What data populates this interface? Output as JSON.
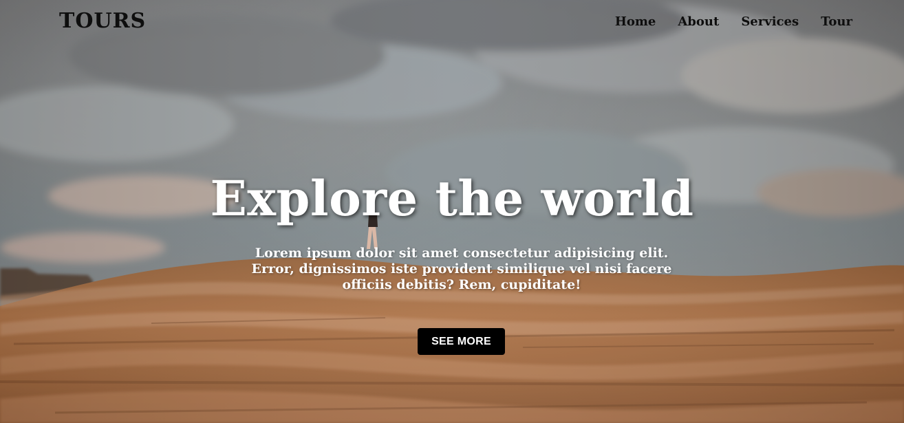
{
  "navbar": {
    "brand": "TOURS",
    "links": [
      "Home",
      "About",
      "Services",
      "Tour"
    ]
  },
  "hero": {
    "title": "Explore the world",
    "description": "Lorem ipsum dolor sit amet consectetur adipisicing elit. Error, dignissimos iste provident similique vel nisi facere officiis debitis? Rem, cupiditate!",
    "button_label": "SEE MORE"
  },
  "colors": {
    "nav_text": "#0e0e0e",
    "hero_text": "#ffffff",
    "button_bg": "#000000",
    "button_text": "#ffffff"
  }
}
